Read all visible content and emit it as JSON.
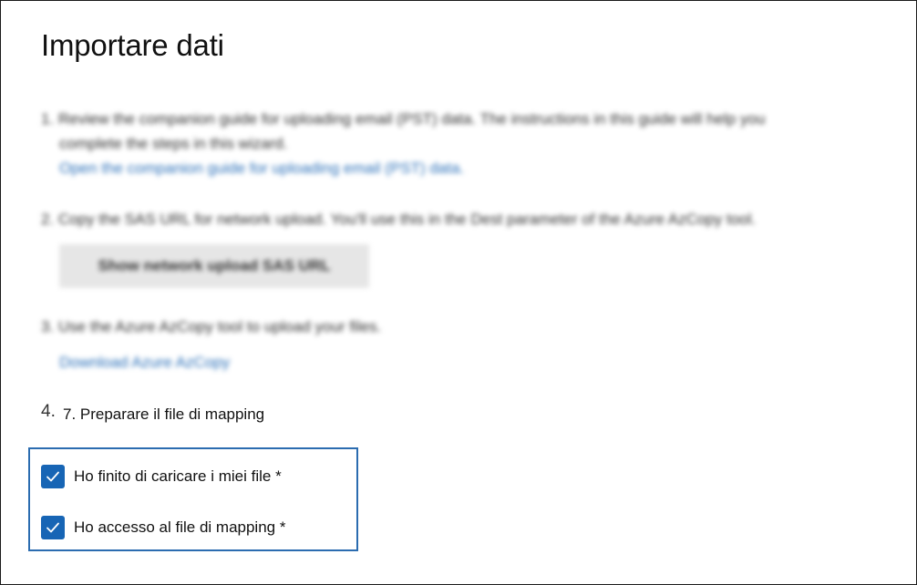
{
  "page": {
    "title": "Importare dati"
  },
  "steps": {
    "s1_line1": "1. Review the companion guide for uploading email (PST) data. The instructions in this guide will help you",
    "s1_line2": "complete the steps in this wizard.",
    "s1_link": "Open the companion guide for uploading email (PST) data.",
    "s2_text": "2. Copy the SAS URL for network upload. You'll use this in the Dest parameter of the Azure AzCopy tool.",
    "s2_button": "Show network upload SAS URL",
    "s3_text": "3. Use the Azure AzCopy tool to upload your files.",
    "s3_link": "Download Azure AzCopy",
    "s4_number": "4.",
    "s4_text": "7. Preparare il file di mapping"
  },
  "checkboxes": [
    {
      "label": "Ho finito di caricare i miei file *",
      "checked": true
    },
    {
      "label": "Ho accesso al file di mapping *",
      "checked": true
    }
  ],
  "colors": {
    "checkbox_fill": "#1765b5",
    "focus_border": "#2b6cb0",
    "link": "#2a6fb8"
  },
  "icons": {
    "checkbox": "checkmark-icon"
  }
}
